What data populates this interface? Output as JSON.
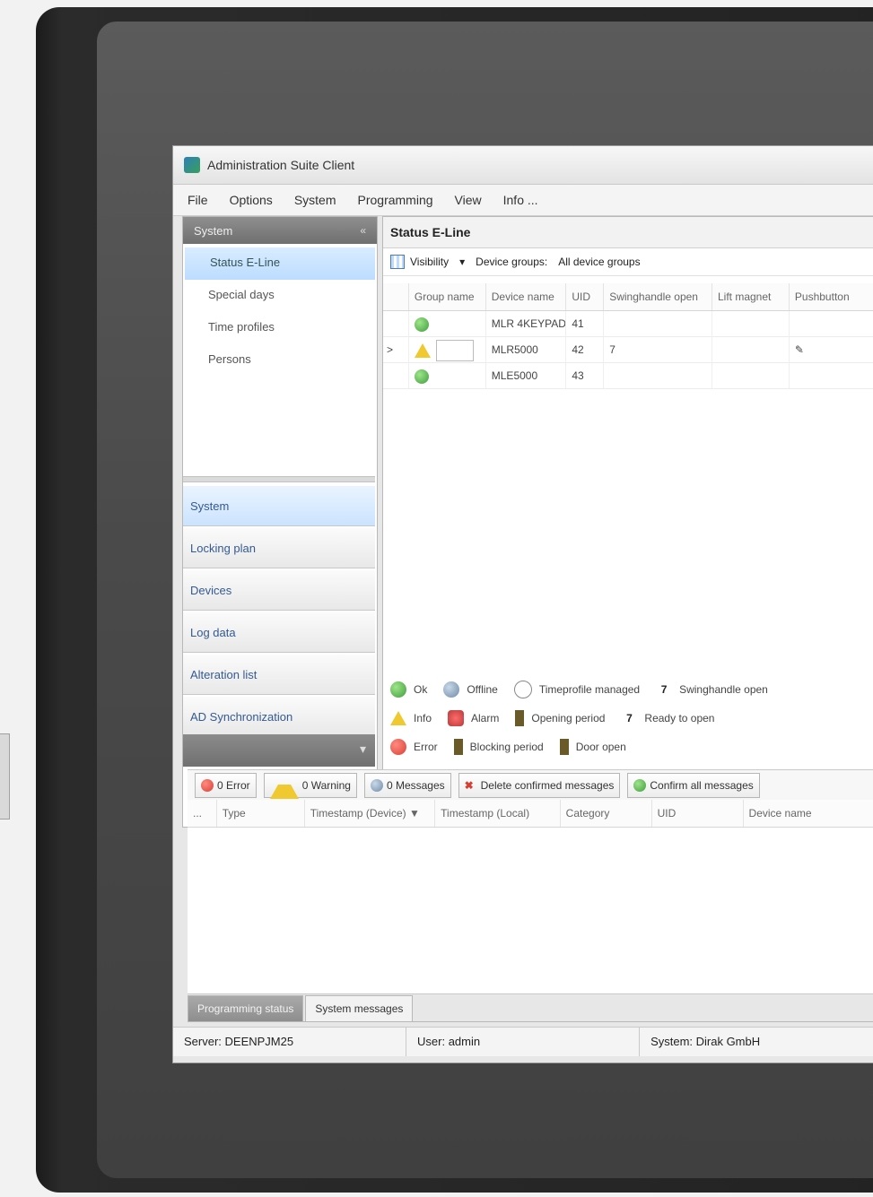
{
  "window": {
    "title": "Administration Suite Client"
  },
  "menu": [
    "File",
    "Options",
    "System",
    "Programming",
    "View",
    "Info ..."
  ],
  "left_panel": {
    "header": "System",
    "collapse_glyph": "«",
    "subitems": [
      "Status E-Line",
      "Special days",
      "Time profiles",
      "Persons"
    ],
    "nav": [
      "System",
      "Locking plan",
      "Devices",
      "Log data",
      "Alteration list",
      "AD Synchronization"
    ],
    "expand_glyph": "▾"
  },
  "main": {
    "title": "Status E-Line",
    "toolbar": {
      "visibility": "Visibility",
      "visibility_glyph": "▾",
      "device_groups_label": "Device groups:",
      "device_groups_value": "All device groups"
    },
    "columns": [
      "Group name",
      "Device name",
      "UID",
      "Swinghandle open",
      "Lift magnet",
      "Pushbutton"
    ],
    "rows": [
      {
        "status": "ok",
        "device": "MLR 4KEYPAD",
        "uid": "41",
        "swing": "",
        "lift": "",
        "push": ""
      },
      {
        "status": "warning",
        "device": "MLR5000",
        "uid": "42",
        "swing": "7",
        "lift": "",
        "push": "✎"
      },
      {
        "status": "ok",
        "device": "MLE5000",
        "uid": "43",
        "swing": "",
        "lift": "",
        "push": ""
      }
    ],
    "row_expander": ">"
  },
  "legend": {
    "row1": [
      "Ok",
      "Offline",
      "Timeprofile managed",
      "Swinghandle open"
    ],
    "row2": [
      "Info",
      "Alarm",
      "Opening period",
      "Ready to open"
    ],
    "row3": [
      "Error",
      "Blocking period",
      "Door open"
    ]
  },
  "messages": {
    "error_btn": "0 Error",
    "warning_btn": "0 Warning",
    "messages_btn": "0 Messages",
    "delete_btn": "Delete confirmed messages",
    "confirm_btn": "Confirm all messages",
    "log_columns": [
      "...",
      "Type",
      "Timestamp (Device)",
      "Timestamp (Local)",
      "Category",
      "UID",
      "Device name"
    ],
    "sort_glyph": "▼"
  },
  "tabs": [
    "Programming status",
    "System messages"
  ],
  "status": {
    "server": "Server: DEENPJM25",
    "user": "User: admin",
    "system": "System: Dirak GmbH"
  }
}
